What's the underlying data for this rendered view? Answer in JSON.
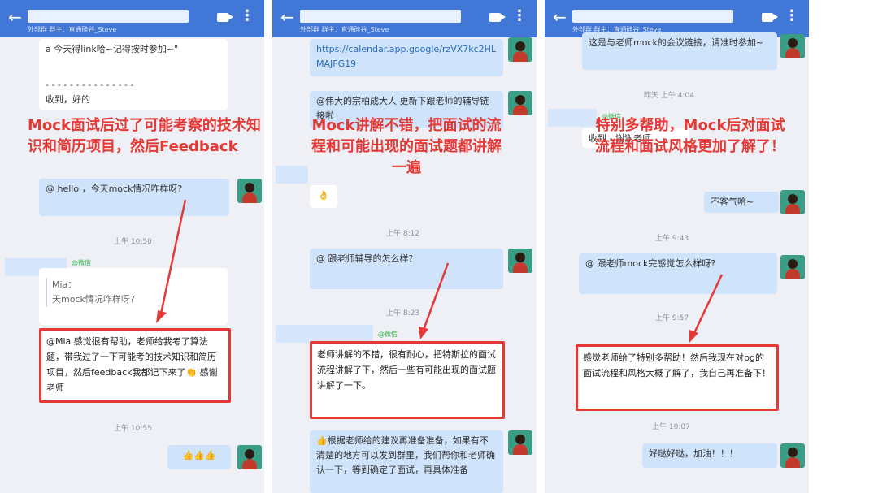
{
  "panels": [
    {
      "subtitle": "外部群 群主：直通硅谷_Steve",
      "msg_top": "a 今天得link哈~记得按时参加~\"",
      "msg_dash": "- - - - - - - - - - - - - - -",
      "msg_reply": "收到，好的",
      "annotation": "Mock面试后过了可能考察的技术知识和简历项目，然后Feedback",
      "msg_hello": "@ hello ，今天mock情况咋样呀?",
      "time1": "上午 10:50",
      "wechat_tag": "@微信",
      "quote_name": "Mia：",
      "quote_text": "天mock情况咋样呀?",
      "highlight": "@Mia 感觉很有帮助，老师给我考了算法题，带我过了一下可能考的技术知识和简历项目，然后feedback我都记下来了👏 感谢老师",
      "time2": "上午 10:55",
      "thumbs": "👍👍👍"
    },
    {
      "subtitle": "外部群 群主：直通硅谷_Steve",
      "link_text": "https://calendar.app.google/rzVX7kc2HLMAJFG19",
      "msg_update": "@伟大的宗柏成大人 更新下跟老师的辅导链接啦",
      "annotation": "Mock讲解不错，把面试的流程和可能出现的面试题都讲解一遍",
      "ok_emoji": "👌",
      "time1": "上午 8:12",
      "msg_ask": "@ 跟老师辅导的怎么样?",
      "time2": "上午 8:23",
      "wechat_tag": "@微信",
      "highlight": "老师讲解的不错，很有耐心，把特斯拉的面试流程讲解了下，然后一些有可能出现的面试题讲解了一下。",
      "msg_advice": "👍根据老师给的建议再准备准备，如果有不清楚的地方可以发到群里，我们帮你和老师确认一下，等到确定了面试，再具体准备"
    },
    {
      "subtitle": "外部群 群主：直通硅谷_Steve",
      "msg_top": "这是与老师mock的会议链接，请准时参加~",
      "time1": "昨天 上午 4:04",
      "wechat_tag": "@微信",
      "msg_thanks": "收到 - 谢谢老师",
      "annotation": "特别多帮助，Mock后对面试流程和面试风格更加了解了！",
      "msg_welcome": "不客气哈~",
      "time2": "上午 9:43",
      "msg_ask": "@ 跟老师mock完感觉怎么样呀?",
      "time3": "上午 9:57",
      "highlight": "感觉老师给了特别多帮助！然后我现在对pg的面试流程和风格大概了解了，我自己再准备下！",
      "time4": "上午 10:07",
      "msg_cheer": "好哒好哒，加油！！！"
    }
  ]
}
